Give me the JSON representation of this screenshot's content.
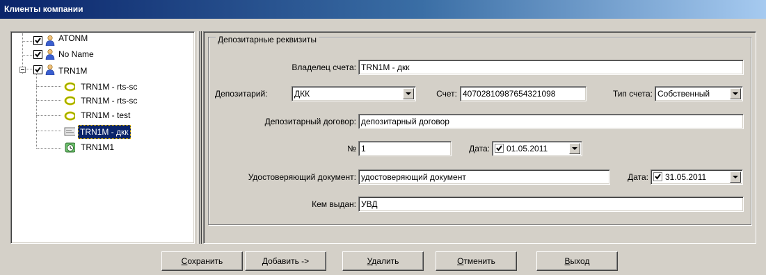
{
  "window": {
    "title": "Клиенты компании"
  },
  "tree": {
    "nodes": [
      {
        "label": "ATONM"
      },
      {
        "label": "No Name"
      },
      {
        "label": "TRN1M"
      },
      {
        "label": "TRN1M - rts-sc"
      },
      {
        "label": "TRN1M - rts-sc"
      },
      {
        "label": "TRN1M - test"
      },
      {
        "label": "TRN1M - дкк"
      },
      {
        "label": "TRN1M1"
      }
    ]
  },
  "form": {
    "group_title": "Депозитарные реквизиты",
    "owner": {
      "label": "Владелец счета:",
      "value": "TRN1M - дкк"
    },
    "depositary": {
      "label": "Депозитарий:",
      "value": "ДКК"
    },
    "account": {
      "label": "Счет:",
      "value": "40702810987654321098"
    },
    "account_type": {
      "label": "Тип счета:",
      "value": "Собственный"
    },
    "contract": {
      "label": "Депозитарный договор:",
      "value": "депозитарный договор"
    },
    "number": {
      "label": "№",
      "value": "1"
    },
    "contract_date": {
      "label": "Дата:",
      "value": "01.05.2011",
      "checked": true
    },
    "id_document": {
      "label": "Удостоверяющий документ:",
      "value": "удостоверяющий документ"
    },
    "id_date": {
      "label": "Дата:",
      "value": "31.05.2011",
      "checked": true
    },
    "issued_by": {
      "label": "Кем выдан:",
      "value": "УВД"
    }
  },
  "buttons": {
    "save_accel": "С",
    "save_rest": "охранить",
    "add": "Добавить ->",
    "delete_accel": "У",
    "delete_rest": "далить",
    "cancel_accel": "О",
    "cancel_rest": "тменить",
    "exit_accel": "В",
    "exit_rest": "ыход"
  },
  "icons": {
    "user": "user-icon",
    "ring": "ring-icon",
    "card": "card-icon",
    "clock": "alarm-clock-icon"
  }
}
